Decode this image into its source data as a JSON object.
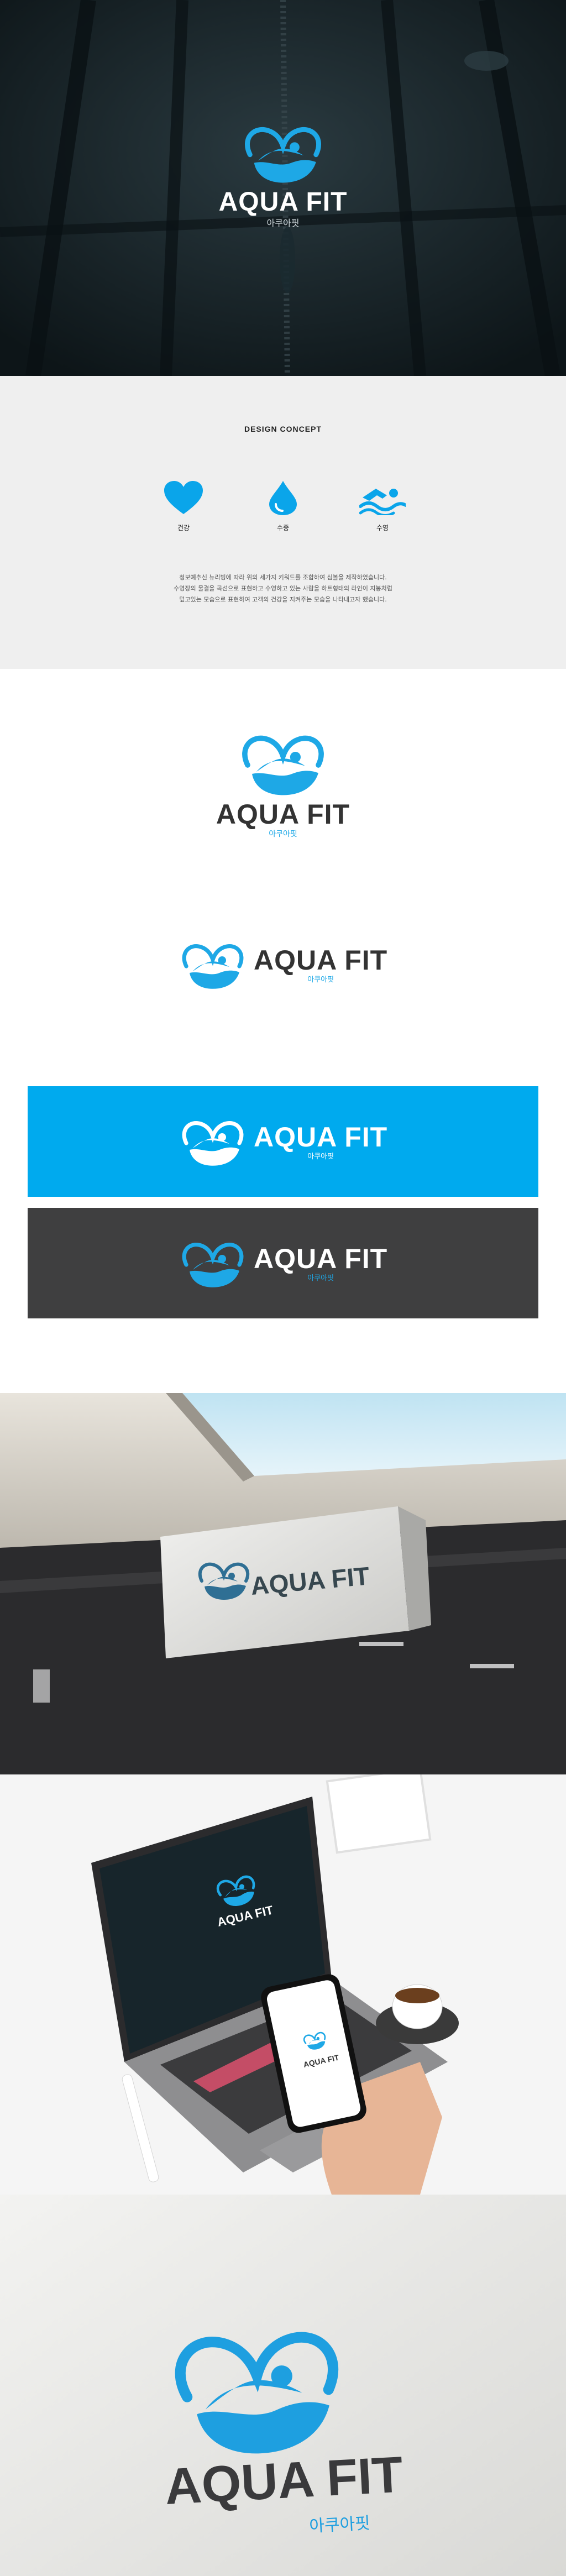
{
  "brand": {
    "name": "AQUA FIT",
    "name_kr": "아쿠아핏",
    "colors": {
      "primary": "#00AAEE",
      "dark": "#3F3F40",
      "text": "#333333",
      "white": "#FFFFFF"
    }
  },
  "concept": {
    "title": "DESIGN CONCEPT",
    "icons": [
      {
        "icon": "heart-icon",
        "label": "건강"
      },
      {
        "icon": "water-drop-icon",
        "label": "수중"
      },
      {
        "icon": "swimmer-icon",
        "label": "수영"
      }
    ],
    "description": [
      "청보예추신 뉴리빙에 따라 위의 세가지 키워드를 조합하여 심볼을 제작하였습니다.",
      "수영장의 물결을 곡선으로 표현하고 수영하고 있는 사람을 하트형태의 라인이 지붕처럼",
      "덮고있는 모습으로 표현하여 고객의 건강을 지켜주는 모습을 나타내고자 했습니다."
    ]
  },
  "mockups": {
    "sign_icon": "hanging-sign-mockup",
    "laptop_icon": "laptop-phone-mockup",
    "paper_icon": "embossed-paper-mockup"
  }
}
